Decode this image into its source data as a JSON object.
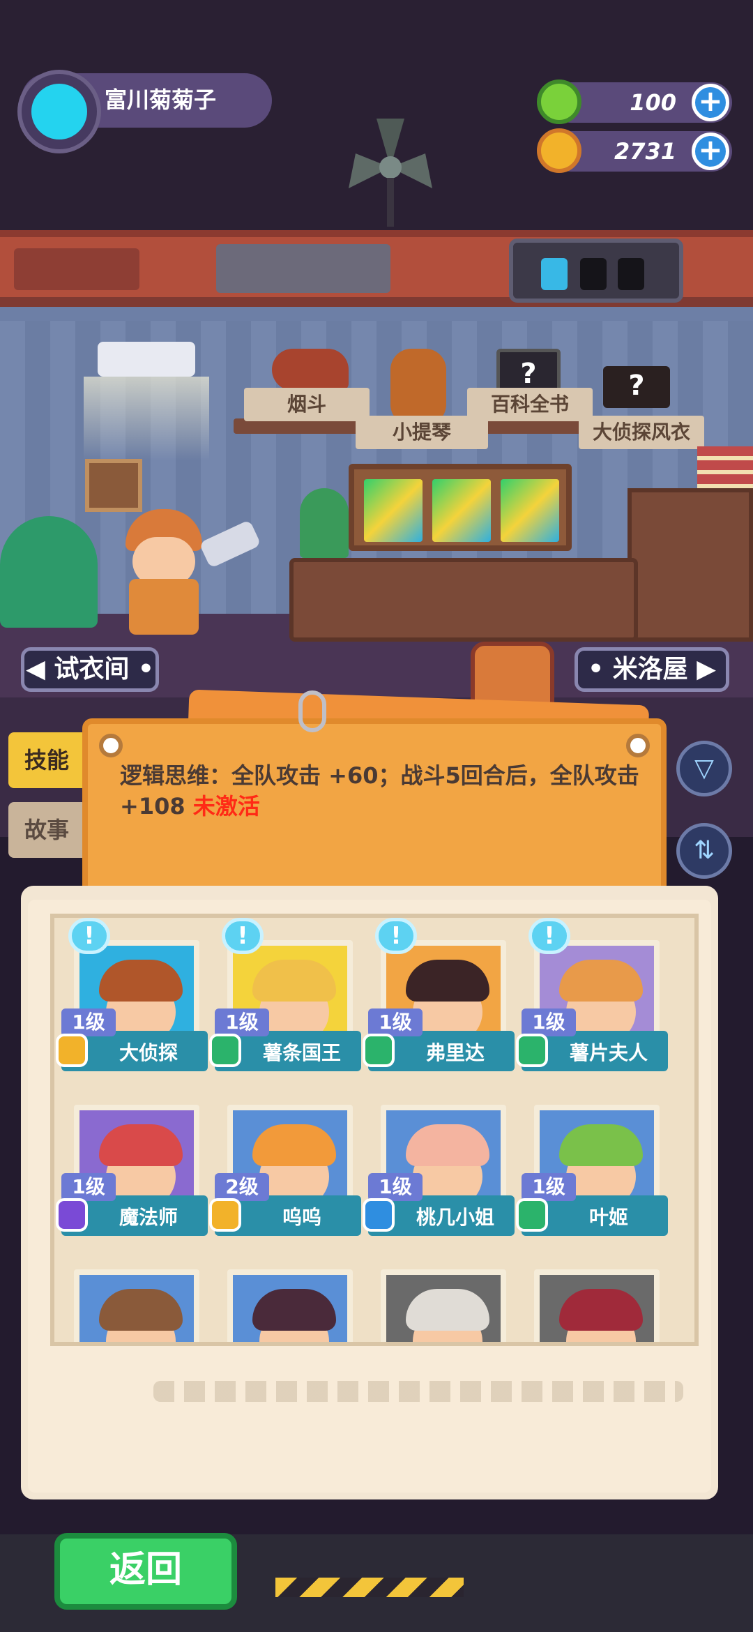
{
  "player": {
    "name": "富川菊菊子"
  },
  "currencies": {
    "gems": "100",
    "coins": "2731"
  },
  "shelf_items": [
    "烟斗",
    "小提琴",
    "百科全书",
    "大侦探风衣"
  ],
  "nav": {
    "left": "试衣间",
    "right": "米洛屋"
  },
  "tabs": [
    "技能",
    "故事"
  ],
  "skill": {
    "text": "逻辑思维：全队攻击 +60；战斗5回合后，全队攻击 +108",
    "status": "未激活"
  },
  "characters": [
    {
      "level": "1级",
      "name": "大侦探",
      "hair": "#b0562a",
      "bg": "#2fb0e0",
      "badge": "#f2b22a"
    },
    {
      "level": "1级",
      "name": "薯条国王",
      "hair": "#f0c04a",
      "bg": "#f4d33b",
      "badge": "#2bb36b"
    },
    {
      "level": "1级",
      "name": "弗里达",
      "hair": "#3b2426",
      "bg": "#f2a544",
      "badge": "#2bb36b"
    },
    {
      "level": "1级",
      "name": "薯片夫人",
      "hair": "#e89a4a",
      "bg": "#a48cd6",
      "badge": "#2bb36b"
    },
    {
      "level": "1级",
      "name": "魔法师",
      "hair": "#d94a4a",
      "bg": "#8a6ad0",
      "badge": "#7a4ad6"
    },
    {
      "level": "2级",
      "name": "呜呜",
      "hair": "#f29a3a",
      "bg": "#5a8fd6",
      "badge": "#f2b22a"
    },
    {
      "level": "1级",
      "name": "桃几小姐",
      "hair": "#f4b4a0",
      "bg": "#5a8fd6",
      "badge": "#2f8ee0"
    },
    {
      "level": "1级",
      "name": "叶姬",
      "hair": "#7ac14a",
      "bg": "#5a8fd6",
      "badge": "#2bb36b"
    },
    {
      "level": "",
      "name": "",
      "hair": "#8a5a3a",
      "bg": "#5a8fd6",
      "badge": ""
    },
    {
      "level": "",
      "name": "",
      "hair": "#4a2a3a",
      "bg": "#5a8fd6",
      "badge": ""
    },
    {
      "level": "",
      "name": "",
      "hair": "#e0dcd6",
      "bg": "#6a6a6a",
      "badge": ""
    },
    {
      "level": "",
      "name": "",
      "hair": "#a02a3a",
      "bg": "#6a6a6a",
      "badge": ""
    }
  ],
  "back_button": "返回",
  "colors": {
    "accent": "#f2a544",
    "inactive_red": "#ff2a16",
    "back_green": "#3ad066"
  }
}
